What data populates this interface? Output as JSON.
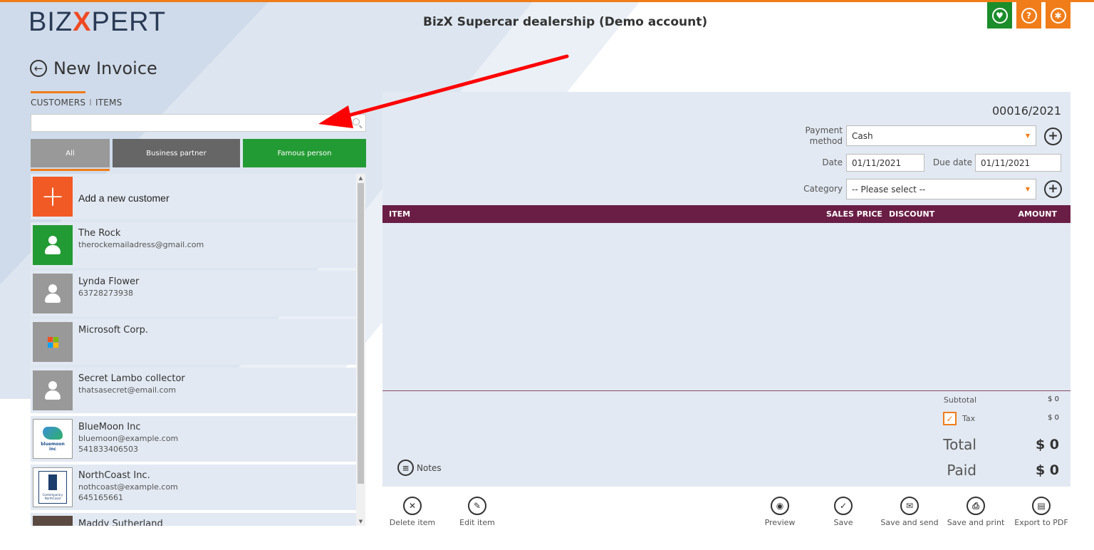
{
  "brand": {
    "logo_left": "BIZ",
    "logo_x": "X",
    "logo_right": "PERT"
  },
  "app_title": "BizX Supercar dealership (Demo account)",
  "page_title": "New Invoice",
  "tabs": {
    "customers": "CUSTOMERS",
    "separator": "I",
    "items": "ITEMS"
  },
  "search": {
    "placeholder": ""
  },
  "filters": [
    "All",
    "Business partner",
    "Famous person"
  ],
  "customer_list": {
    "add_label": "Add a new customer",
    "customers": [
      {
        "name": "The Rock",
        "line1": "therockemailadress@gmail.com",
        "line2": ""
      },
      {
        "name": "Lynda Flower",
        "line1": "63728273938",
        "line2": ""
      },
      {
        "name": "Microsoft Corp.",
        "line1": "",
        "line2": ""
      },
      {
        "name": "Secret Lambo collector",
        "line1": "thatsasecret@email.com",
        "line2": ""
      },
      {
        "name": "BlueMoon Inc",
        "line1": "bluemoon@example.com",
        "line2": "541833406503"
      },
      {
        "name": "NorthCoast Inc.",
        "line1": "nothcoast@example.com",
        "line2": "645165661"
      },
      {
        "name": "Maddy Sutherland",
        "line1": "",
        "line2": ""
      }
    ],
    "logo_texts": {
      "bluemoon": "bluemoon inc",
      "northcoast": "Contemporary NorthCoast"
    }
  },
  "invoice": {
    "number": "00016/2021",
    "payment_method_label": "Payment method",
    "payment_method_value": "Cash",
    "date_label": "Date",
    "date_value": "01/11/2021",
    "due_date_label": "Due date",
    "due_date_value": "01/11/2021",
    "category_label": "Category",
    "category_value": "-- Please select --",
    "columns": {
      "item": "ITEM",
      "sales_price": "SALES PRICE",
      "discount": "DISCOUNT",
      "amount": "AMOUNT"
    },
    "subtotal_label": "Subtotal",
    "subtotal_value": "$ 0",
    "tax_label": "Tax",
    "tax_value": "$ 0",
    "tax_checked": true,
    "total_label": "Total",
    "total_value": "$ 0",
    "paid_label": "Paid",
    "paid_value": "$ 0",
    "notes_label": "Notes"
  },
  "actions": {
    "delete_item": "Delete item",
    "edit_item": "Edit item",
    "preview": "Preview",
    "save": "Save",
    "save_and_send": "Save and send",
    "save_and_print": "Save and print",
    "export_pdf": "Export to PDF"
  },
  "colors": {
    "accent_orange": "#f07d1a",
    "famous_green": "#239b34",
    "header_plum": "#6b1e45",
    "annotation_red": "#ff0000"
  }
}
